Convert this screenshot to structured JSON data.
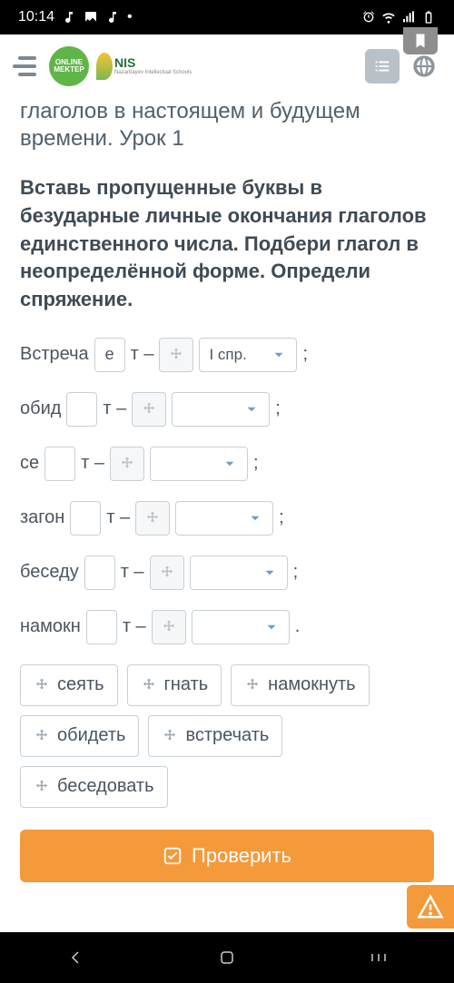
{
  "status": {
    "time": "10:14"
  },
  "logos": {
    "online_top": "ONLINE",
    "online_bottom": "MEKTEP",
    "nis": "NIS",
    "nis_sub": "Nazarbayev Intellectual Schools"
  },
  "lesson": {
    "title_fragment": "глаголов в настоящем и будущем времени. Урок 1",
    "instructions": "Вставь пропущенные буквы в безударные личные окончания глаголов единственного числа. Подбери глагол в неопределённой форме. Определи спряжение."
  },
  "rows": [
    {
      "stem": "Встреча",
      "letter": "е",
      "suffix": "т –",
      "select": "I спр.",
      "punct": ";"
    },
    {
      "stem": "обид",
      "letter": "",
      "suffix": "т –",
      "select": "",
      "punct": ";"
    },
    {
      "stem": "се",
      "letter": "",
      "suffix": "т –",
      "select": "",
      "punct": ";"
    },
    {
      "stem": "загон",
      "letter": "",
      "suffix": "т –",
      "select": "",
      "punct": ";"
    },
    {
      "stem": "беседу",
      "letter": "",
      "suffix": "т –",
      "select": "",
      "punct": ";"
    },
    {
      "stem": "намокн",
      "letter": "",
      "suffix": "т –",
      "select": "",
      "punct": "."
    }
  ],
  "word_bank": [
    "сеять",
    "гнать",
    "намокнуть",
    "обидеть",
    "встречать",
    "беседовать"
  ],
  "buttons": {
    "check": "Проверить"
  }
}
